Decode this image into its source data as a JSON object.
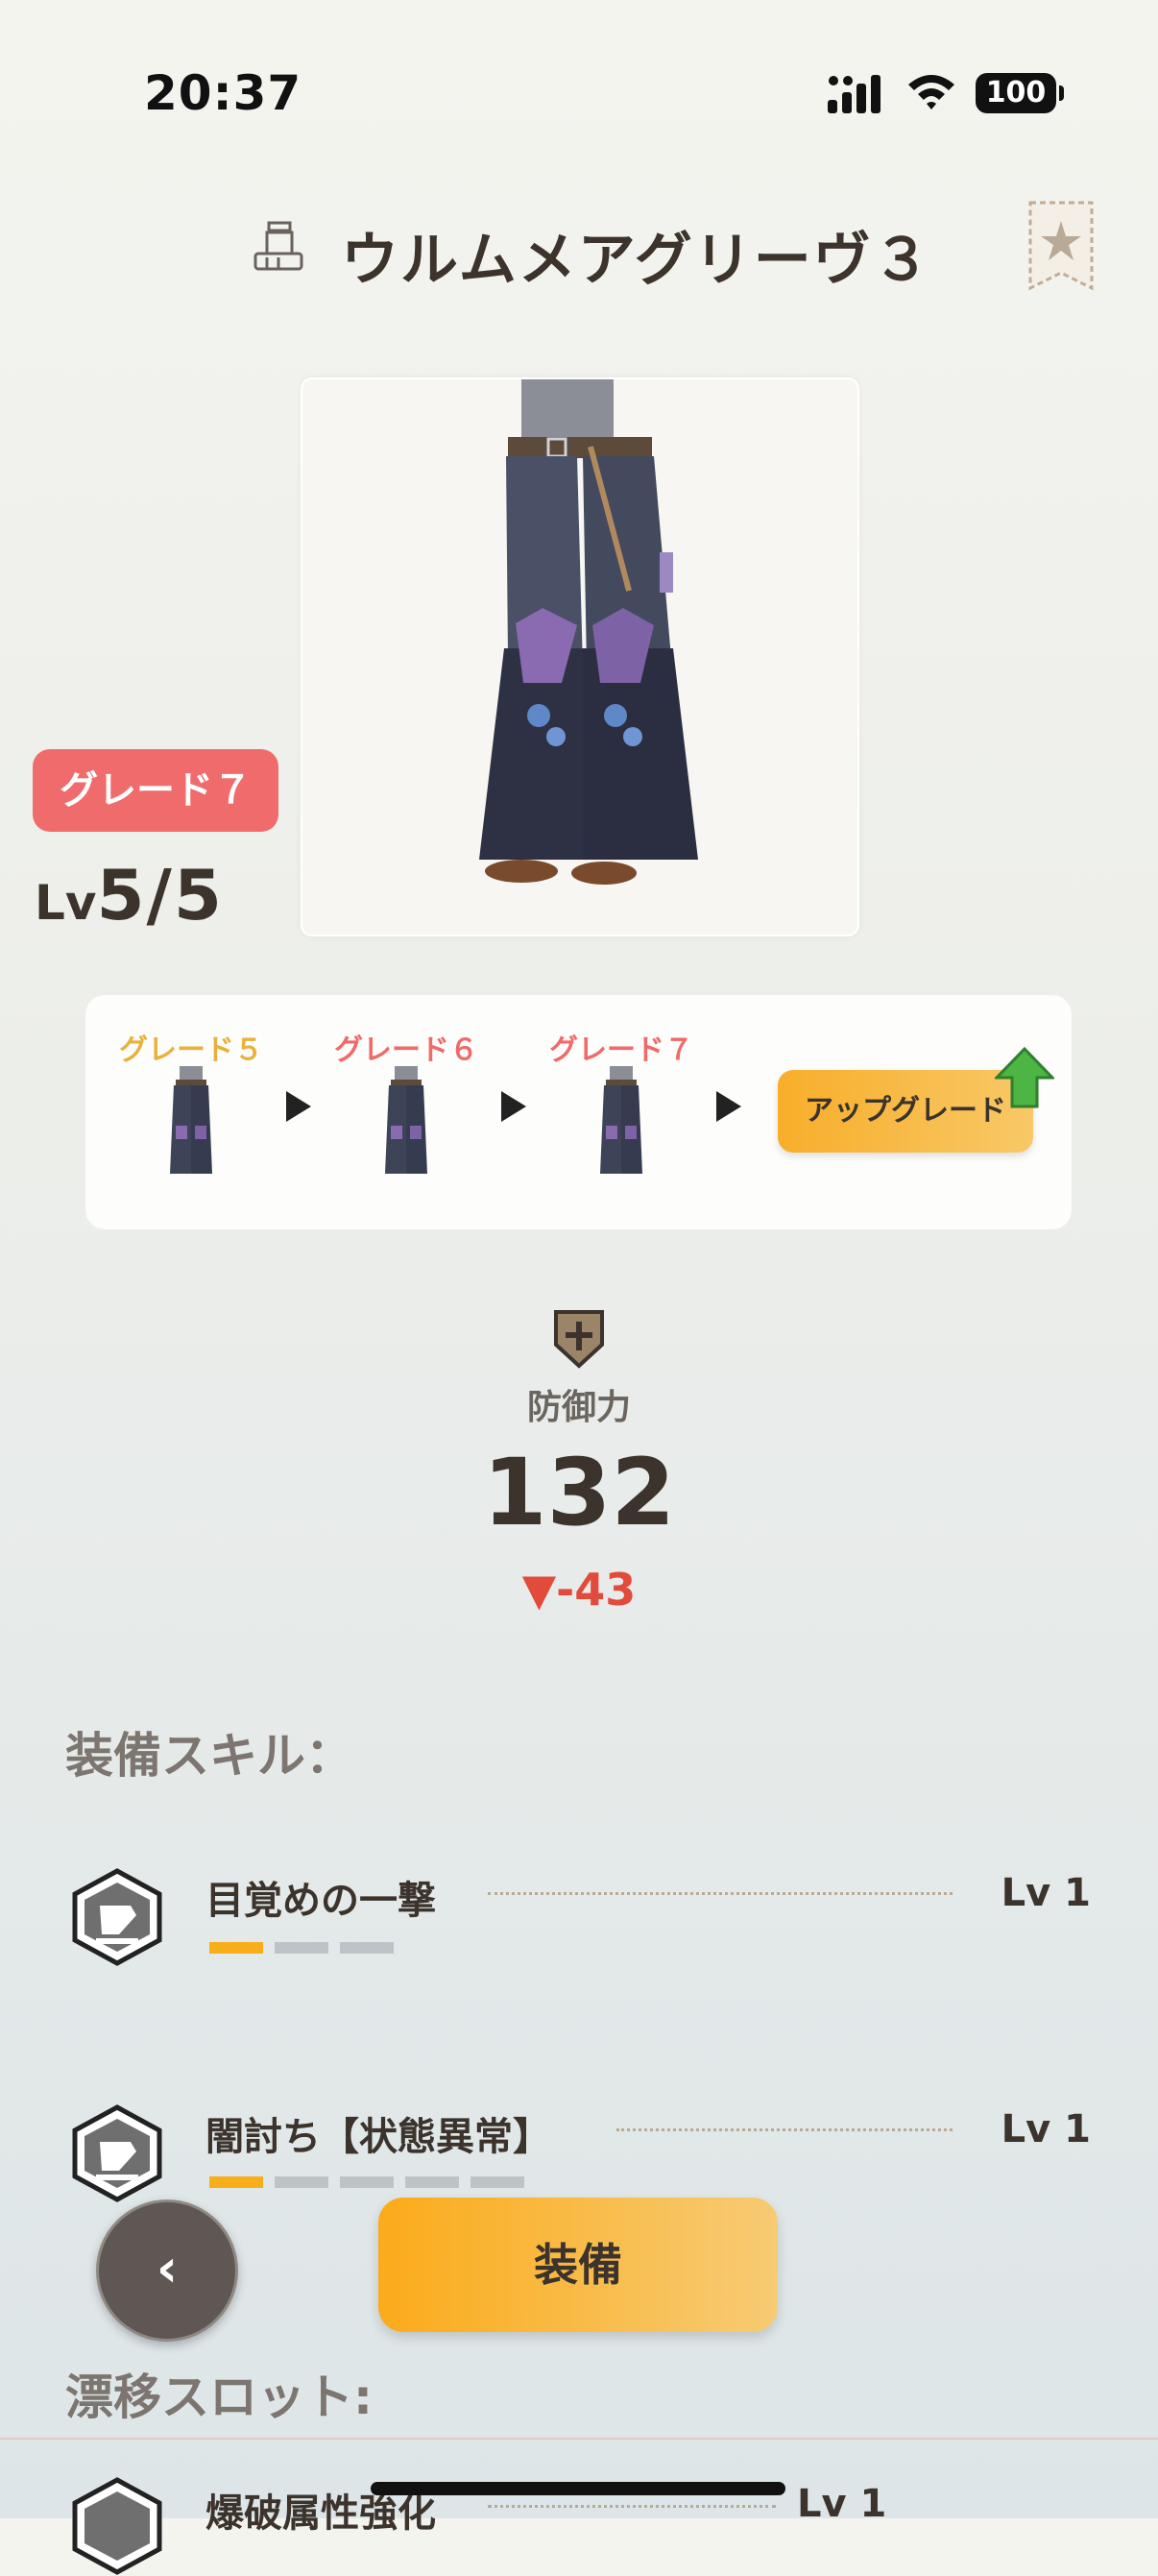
{
  "status_bar": {
    "time": "20:37",
    "battery": "100"
  },
  "header": {
    "title": "ウルムメアグリーヴ３"
  },
  "equipment": {
    "grade_badge": "グレード７",
    "level_prefix": "Lv",
    "level_value": "5/5"
  },
  "grade_path": {
    "steps": [
      {
        "label": "グレード５",
        "color": "#e8b23a"
      },
      {
        "label": "グレード６",
        "color": "#ef6a6a"
      },
      {
        "label": "グレード７",
        "color": "#ef6a6a"
      }
    ],
    "upgrade_label": "アップグレード"
  },
  "defense": {
    "label": "防御力",
    "value": "132",
    "diff": "▼-43"
  },
  "skills_section": {
    "title": "装備スキル：",
    "items": [
      {
        "name": "目覚めの一撃",
        "level": "Lv 1",
        "pips_total": 3,
        "pips_filled": 1
      },
      {
        "name": "闇討ち【状態異常】",
        "level": "Lv 1",
        "pips_total": 5,
        "pips_filled": 1
      }
    ]
  },
  "buttons": {
    "back": "‹",
    "equip": "装備"
  },
  "drift_slot_section": {
    "title": "漂移スロット:",
    "items": [
      {
        "name": "爆破属性強化",
        "level": "Lv 1"
      }
    ]
  },
  "colors": {
    "accent": "#f8ae1a",
    "grade_badge": "#f06c6c",
    "diff_down": "#e24a3c"
  }
}
